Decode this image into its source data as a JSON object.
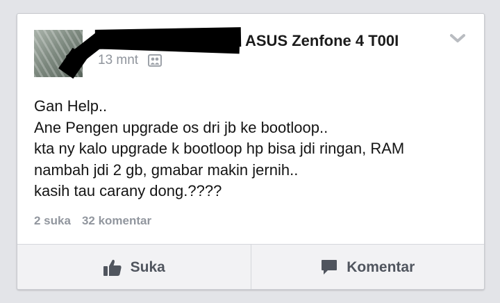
{
  "post": {
    "author_suffix": "ASUS Zenfone 4 T00I",
    "timestamp": "13 mnt",
    "audience_icon": "friends-icon",
    "lines": [
      "Gan Help..",
      "Ane Pengen upgrade os dri jb ke bootloop..",
      "kta ny kalo upgrade k bootloop hp bisa jdi ringan, RAM",
      "nambah jdi 2 gb, gmabar makin jernih..",
      "kasih tau carany dong.????"
    ]
  },
  "stats": {
    "likes": "2 suka",
    "comments": "32 komentar"
  },
  "actions": {
    "like_label": "Suka",
    "comment_label": "Komentar"
  },
  "colors": {
    "background": "#e3e4e8",
    "card": "#ffffff",
    "muted_text": "#91969e",
    "action_text": "#50555e"
  }
}
